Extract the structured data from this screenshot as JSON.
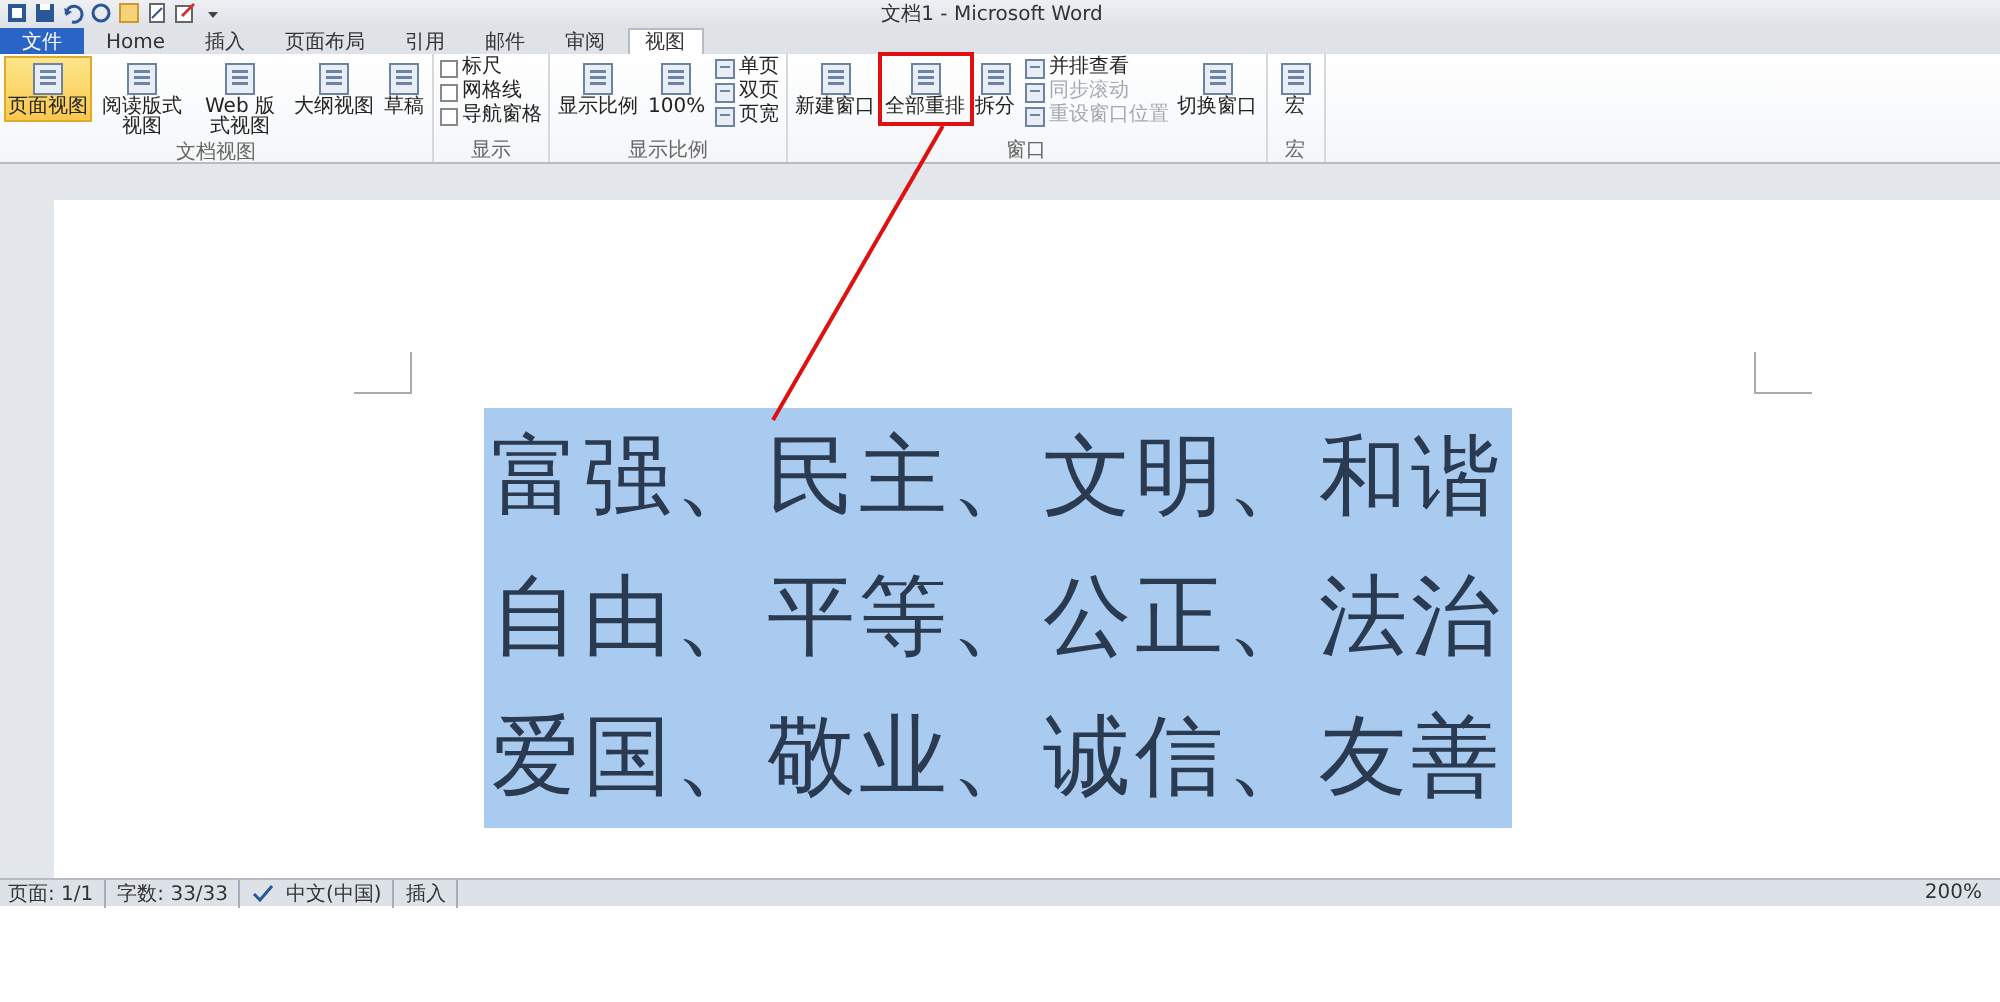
{
  "window": {
    "title": "文档1 - Microsoft Word"
  },
  "tabs": [
    {
      "label": "文件",
      "kind": "file",
      "selected": false
    },
    {
      "label": "Home",
      "kind": "tab",
      "selected": false
    },
    {
      "label": "插入",
      "kind": "tab",
      "selected": false
    },
    {
      "label": "页面布局",
      "kind": "tab",
      "selected": false
    },
    {
      "label": "引用",
      "kind": "tab",
      "selected": false
    },
    {
      "label": "邮件",
      "kind": "tab",
      "selected": false
    },
    {
      "label": "审阅",
      "kind": "tab",
      "selected": false
    },
    {
      "label": "视图",
      "kind": "tab",
      "selected": true
    }
  ],
  "ribbon": {
    "groups": [
      {
        "label": "文档视图",
        "items": [
          {
            "kind": "large",
            "label": "页面视图",
            "selected": true
          },
          {
            "kind": "large",
            "label": "阅读版式视图",
            "selected": false
          },
          {
            "kind": "large",
            "label": "Web 版式视图",
            "selected": false
          },
          {
            "kind": "large",
            "label": "大纲视图",
            "selected": false
          },
          {
            "kind": "large",
            "label": "草稿",
            "selected": false
          }
        ]
      },
      {
        "label": "显示",
        "items": [
          {
            "kind": "check",
            "label": "标尺",
            "checked": false
          },
          {
            "kind": "check",
            "label": "网格线",
            "checked": false
          },
          {
            "kind": "check",
            "label": "导航窗格",
            "checked": false
          }
        ]
      },
      {
        "label": "显示比例",
        "items": [
          {
            "kind": "large",
            "label": "显示比例",
            "selected": false
          },
          {
            "kind": "large",
            "label": "100%",
            "selected": false
          },
          {
            "kind": "small",
            "label": "单页",
            "disabled": false
          },
          {
            "kind": "small",
            "label": "双页",
            "disabled": false
          },
          {
            "kind": "small",
            "label": "页宽",
            "disabled": false
          }
        ]
      },
      {
        "label": "窗口",
        "items": [
          {
            "kind": "large",
            "label": "新建窗口",
            "selected": false
          },
          {
            "kind": "large",
            "label": "全部重排",
            "selected": false,
            "highlighted": true
          },
          {
            "kind": "large",
            "label": "拆分",
            "selected": false
          },
          {
            "kind": "small",
            "label": "并排查看",
            "disabled": false
          },
          {
            "kind": "small",
            "label": "同步滚动",
            "disabled": true
          },
          {
            "kind": "small",
            "label": "重设窗口位置",
            "disabled": true
          },
          {
            "kind": "large",
            "label": "切换窗口",
            "selected": false
          }
        ]
      },
      {
        "label": "宏",
        "items": [
          {
            "kind": "large",
            "label": "宏",
            "selected": false
          }
        ]
      }
    ]
  },
  "document": {
    "selected": true,
    "lines": [
      "富强、民主、文明、和谐",
      "自由、平等、公正、法治",
      "爱国、敬业、诚信、友善"
    ]
  },
  "status_bar": {
    "items": [
      "页面: 1/1",
      "字数: 33/33",
      "中文(中国)",
      "插入"
    ],
    "zoom": "200%"
  }
}
